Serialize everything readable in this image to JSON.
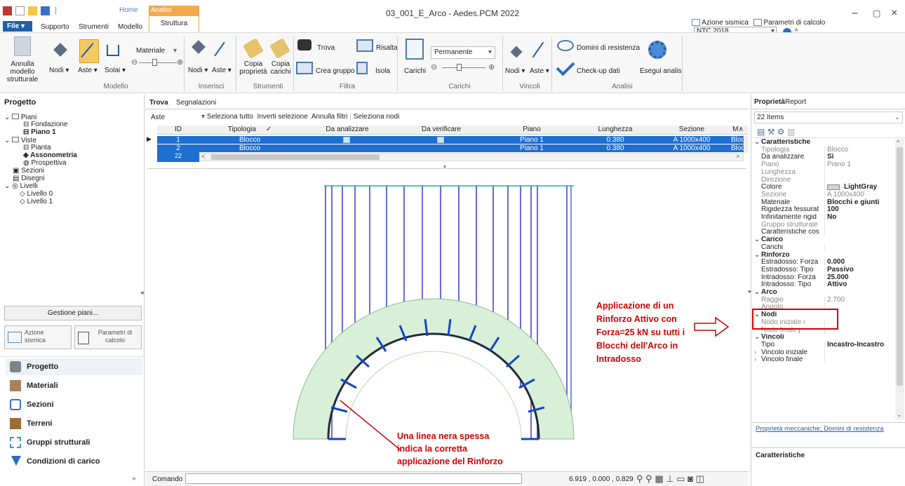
{
  "window": {
    "title": "03_001_E_Arco - Aedes.PCM 2022"
  },
  "menu": {
    "file": "File",
    "home": "Home",
    "context_group": "Analisi Elastiche",
    "context_tab": "Struttura",
    "tabs": [
      "Supporto",
      "Strumenti",
      "Modello"
    ]
  },
  "top_right": {
    "azione": "Azione sismica",
    "parametri": "Parametri di calcolo",
    "norm": "NTC 2018"
  },
  "ribbon": {
    "annulla": "Annulla modello strutturale",
    "nodi": "Nodi",
    "aste": "Aste",
    "solai": "Solai",
    "materiale": "Materiale",
    "modello_group": "Modello",
    "ins_nodi": "Nodi",
    "ins_aste": "Aste",
    "inserisci_group": "Inserisci",
    "copia_prop": "Copia proprietà",
    "copia_carichi": "Copia carichi",
    "strumenti_group": "Strumenti",
    "trova": "Trova",
    "risalta": "Risalta",
    "crea_gruppo": "Crea gruppo",
    "isola": "Isola",
    "filtra_group": "Filtra",
    "carichi": "Carichi",
    "permanente": "Permanente",
    "carichi_group": "Carichi",
    "v_nodi": "Nodi",
    "v_aste": "Aste",
    "vincoli_group": "Vincoli",
    "domini": "Domini di resistenza",
    "checkup": "Check-up dati",
    "esegui": "Esegui analisi",
    "analisi_group": "Analisi"
  },
  "project": {
    "header": "Progetto",
    "tree": [
      {
        "label": "Piani",
        "level": 0,
        "bold": false
      },
      {
        "label": "Fondazione",
        "level": 1,
        "bold": false
      },
      {
        "label": "Piano 1",
        "level": 1,
        "bold": true
      },
      {
        "label": "Viste",
        "level": 0,
        "bold": false
      },
      {
        "label": "Pianta",
        "level": 1,
        "bold": false
      },
      {
        "label": "Assonometria",
        "level": 1,
        "bold": true
      },
      {
        "label": "Prospettiva",
        "level": 1,
        "bold": false
      },
      {
        "label": "Sezioni",
        "level": 0,
        "bold": false
      },
      {
        "label": "Disegni",
        "level": 0,
        "bold": false
      },
      {
        "label": "Livelli",
        "level": 0,
        "bold": false
      },
      {
        "label": "Livello 0",
        "level": 1,
        "bold": false
      },
      {
        "label": "Livello 1",
        "level": 1,
        "bold": false
      }
    ],
    "gestione": "Gestione piani...",
    "azione": "Azione sismica",
    "parametri": "Parametri di calcolo",
    "nav": [
      "Progetto",
      "Materiali",
      "Sezioni",
      "Terreni",
      "Gruppi strutturali",
      "Condizioni di carico"
    ]
  },
  "find": {
    "tabs": [
      "Trova",
      "Segnalazioni"
    ],
    "entity": "Aste",
    "actions": [
      "Seleziona tutto",
      "Inverti selezione",
      "Annulla filtri",
      "Seleziona nodi"
    ],
    "columns": [
      "ID",
      "Tipologia",
      "Da analizzare",
      "Da verificare",
      "Piano",
      "Lunghezza",
      "Sezione",
      "M"
    ],
    "rows": [
      {
        "id": "1",
        "tipologia": "Blocco",
        "piano": "Piano 1",
        "lunghezza": "0.380",
        "sezione": "A 1000x400",
        "m": "Bloc"
      },
      {
        "id": "2",
        "tipologia": "Blocco",
        "piano": "Piano 1",
        "lunghezza": "0.380",
        "sezione": "A 1000x400",
        "m": "Bloc"
      },
      {
        "id": "22"
      }
    ]
  },
  "annotations": {
    "right": [
      "Applicazione di un",
      "Rinforzo Attivo con",
      "Forza=25 kN su tutti i",
      "Blocchi dell'Arco in",
      "Intradosso"
    ],
    "bottom": [
      "Una linea nera spessa",
      "indica la corretta",
      "applicazione del Rinforzo"
    ]
  },
  "status": {
    "comando": "Comando",
    "coords": "6.919 , 0.000 , 0.829"
  },
  "props": {
    "tabs": [
      "Proprietà",
      "Report"
    ],
    "count": "22 Items",
    "rows": [
      {
        "k": "Caratteristiche",
        "v": "",
        "cat": true
      },
      {
        "k": "Tipologia",
        "v": "Blocco",
        "muted": true
      },
      {
        "k": "Da analizzare",
        "v": "Sì",
        "bold": true
      },
      {
        "k": "Piano",
        "v": "Piano 1",
        "muted": true
      },
      {
        "k": "Lunghezza",
        "v": "",
        "muted": true
      },
      {
        "k": "Direzione",
        "v": "",
        "muted": true
      },
      {
        "k": "Colore",
        "v": "LightGray",
        "bold": true
      },
      {
        "k": "Sezione",
        "v": "A 1000x400",
        "muted": true
      },
      {
        "k": "Materiale",
        "v": "Blocchi e giunti",
        "bold": true
      },
      {
        "k": "Rigidezza fessurat",
        "v": "100",
        "bold": true
      },
      {
        "k": "Infinitamente rigid",
        "v": "No",
        "bold": true
      },
      {
        "k": "Gruppo strutturale",
        "v": "",
        "muted": true
      },
      {
        "k": "Caratteristiche cos",
        "v": ""
      },
      {
        "k": "Carico",
        "v": "",
        "cat": true
      },
      {
        "k": "Carichi",
        "v": ""
      },
      {
        "k": "Rinforzo",
        "v": "",
        "cat": true
      },
      {
        "k": "Estradosso: Forza",
        "v": "0.000",
        "bold": true
      },
      {
        "k": "Estradosso: Tipo",
        "v": "Passivo",
        "bold": true
      },
      {
        "k": "Intradosso: Forza",
        "v": "25.000",
        "bold": true
      },
      {
        "k": "Intradosso: Tipo",
        "v": "Attivo",
        "bold": true
      },
      {
        "k": "Arco",
        "v": "",
        "cat": true
      },
      {
        "k": "Raggio",
        "v": "2.700",
        "muted": true
      },
      {
        "k": "Angolo",
        "v": "",
        "muted": true
      },
      {
        "k": "Nodi",
        "v": "",
        "cat": true
      },
      {
        "k": "Nodo iniziale i",
        "v": "",
        "muted": true
      },
      {
        "k": "Nodo finale j",
        "v": "",
        "muted": true
      },
      {
        "k": "Vincoli",
        "v": "",
        "cat": true
      },
      {
        "k": "Tipo",
        "v": "Incastro-Incastro",
        "bold": true
      },
      {
        "k": "Vincolo iniziale",
        "v": ""
      },
      {
        "k": "Vincolo finale",
        "v": ""
      }
    ],
    "links": "Proprietà meccaniche; Domini di resistenza",
    "footer": "Caratteristiche"
  },
  "colors": {
    "accent": "#1f5fa8",
    "selection": "#1f6fd0",
    "annotation": "#d00000",
    "context": "#f3a94a"
  }
}
